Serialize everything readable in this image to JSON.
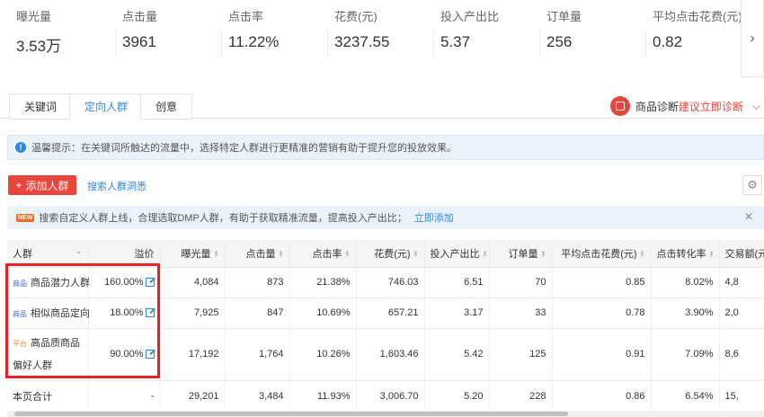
{
  "metrics": [
    {
      "label": "曝光量",
      "value": "3.53万"
    },
    {
      "label": "点击量",
      "value": "3961"
    },
    {
      "label": "点击率",
      "value": "11.22%"
    },
    {
      "label": "花费(元)",
      "value": "3237.55"
    },
    {
      "label": "投入产出比",
      "value": "5.37"
    },
    {
      "label": "订单量",
      "value": "256"
    },
    {
      "label": "平均点击花费(元)",
      "value": "0.82"
    }
  ],
  "metrics_next_icon": "chevron-right-icon",
  "tabs": [
    {
      "label": "关键词",
      "active": false
    },
    {
      "label": "定向人群",
      "active": true
    },
    {
      "label": "创意",
      "active": false
    }
  ],
  "diagnosis": {
    "label": "商品诊断",
    "link": "建议立即诊断"
  },
  "notice": {
    "text": "温馨提示：在关键词所触达的流量中，选择特定人群进行更精准的营销有助于提升您的投放效果。"
  },
  "toolbar": {
    "add_label": "添加人群",
    "search_link": "搜索人群洞悉"
  },
  "banner": {
    "tag": "NEW",
    "text": "搜索自定义人群上线，合理选取DMP人群，有助于获取精准流量，提高投入产出比；",
    "link": "立即添加"
  },
  "table": {
    "headers": [
      "人群",
      "溢价",
      "曝光量",
      "点击量",
      "点击率",
      "花费(元)",
      "投入产出比",
      "订单量",
      "平均点击花费(元)",
      "点击转化率",
      "交易额(元)"
    ],
    "rows": [
      {
        "tag": "商品",
        "name": "商品潜力人群",
        "premium": "160.00%",
        "impressions": "4,084",
        "clicks": "873",
        "ctr": "21.38%",
        "cost": "746.03",
        "roi": "6.51",
        "orders": "70",
        "cpc": "0.85",
        "cvr": "8.02%",
        "gmv": "4,8"
      },
      {
        "tag": "商品",
        "name": "相似商品定向",
        "premium": "18.00%",
        "impressions": "7,925",
        "clicks": "847",
        "ctr": "10.69%",
        "cost": "657.21",
        "roi": "3.17",
        "orders": "33",
        "cpc": "0.78",
        "cvr": "3.90%",
        "gmv": "2,0"
      },
      {
        "tag": "平台",
        "name": "高品质商品偏好人群",
        "premium": "90.00%",
        "impressions": "17,192",
        "clicks": "1,764",
        "ctr": "10.26%",
        "cost": "1,603.46",
        "roi": "5.42",
        "orders": "125",
        "cpc": "0.91",
        "cvr": "7.09%",
        "gmv": "8,6"
      }
    ],
    "total": {
      "label": "本页合计",
      "premium": "-",
      "impressions": "29,201",
      "clicks": "3,484",
      "ctr": "11.93%",
      "cost": "3,006.70",
      "roi": "5.20",
      "orders": "228",
      "cpc": "0.86",
      "cvr": "6.54%",
      "gmv": "15,"
    }
  },
  "colors": {
    "accent": "#3089dc",
    "danger": "#e8453c",
    "highlight": "#e8202a"
  }
}
